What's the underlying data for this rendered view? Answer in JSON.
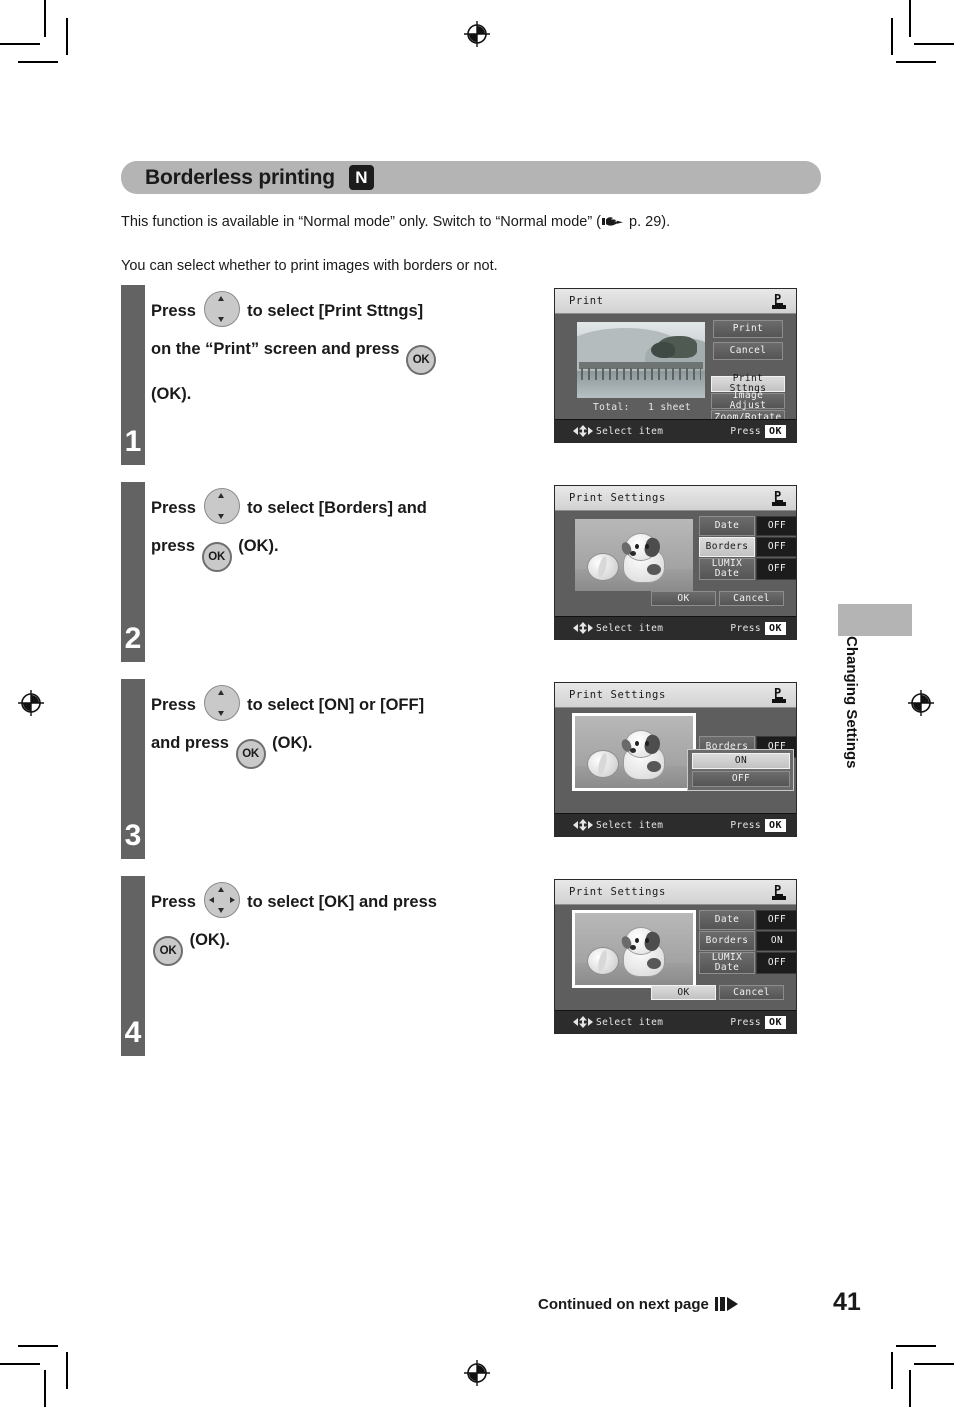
{
  "document": {
    "page_number": "41",
    "side_tab_label": "Changing Settings",
    "footer_note": "Continued on next page"
  },
  "section": {
    "title": "Borderless printing",
    "mode_badge": "N",
    "intro_1_before": "This function is available in “Normal mode” only. Switch to “Normal mode” (",
    "intro_1_after": " p. 29).",
    "intro_2": "You can select whether to print images with borders or not."
  },
  "steps": [
    {
      "number": "1",
      "text_parts": [
        "Press ",
        " to select [Print Sttngs]",
        "on the “Print” screen and press ",
        "(OK)."
      ],
      "line1_pre": "Press",
      "line1_post": "to select [Print Sttngs]",
      "line2_pre": "on the “Print” screen and press",
      "line2_post": "",
      "line3": "(OK).",
      "ok_label": "OK",
      "screen": {
        "title": "Print",
        "icon": "pictbridge-icon",
        "total_label": "Total:",
        "total_value": "1 sheet",
        "buttons": [
          {
            "label": "Print",
            "state": "normal"
          },
          {
            "label": "Cancel",
            "state": "normal"
          },
          {
            "label": "Print Sttngs",
            "state": "selected"
          },
          {
            "label": "Image Adjust",
            "state": "normal"
          },
          {
            "label": "Zoom/Rotate",
            "state": "normal"
          }
        ],
        "footer_left": "Select item",
        "footer_right": "Press",
        "footer_ok": "OK"
      }
    },
    {
      "number": "2",
      "line1_pre": "Press",
      "line1_post": "to select [Borders] and",
      "line2_pre": "press",
      "line2_post": "(OK).",
      "ok_label": "OK",
      "screen": {
        "title": "Print Settings",
        "icon": "pictbridge-icon",
        "rows": [
          {
            "label": "Date",
            "value": "OFF",
            "state": "normal"
          },
          {
            "label": "Borders",
            "value": "OFF",
            "state": "selected"
          },
          {
            "label": "LUMIX Date",
            "value": "OFF",
            "state": "normal"
          }
        ],
        "ok_button": "OK",
        "cancel_button": "Cancel",
        "footer_left": "Select item",
        "footer_right": "Press",
        "footer_ok": "OK"
      }
    },
    {
      "number": "3",
      "line1_pre": "Press",
      "line1_post": "to select [ON] or [OFF]",
      "line2_pre": "and press",
      "line2_post": "(OK).",
      "ok_label": "OK",
      "screen": {
        "title": "Print Settings",
        "icon": "pictbridge-icon",
        "behind_row": {
          "label": "Borders",
          "value": "OFF"
        },
        "popup_options": [
          {
            "label": "ON",
            "state": "selected"
          },
          {
            "label": "OFF",
            "state": "normal"
          }
        ],
        "footer_left": "Select item",
        "footer_right": "Press",
        "footer_ok": "OK"
      }
    },
    {
      "number": "4",
      "line1_pre": "Press",
      "line1_post": "to select [OK] and press",
      "line2_pre": "",
      "line2_post": "(OK).",
      "ok_label": "OK",
      "screen": {
        "title": "Print Settings",
        "icon": "pictbridge-icon",
        "rows": [
          {
            "label": "Date",
            "value": "OFF",
            "state": "normal"
          },
          {
            "label": "Borders",
            "value": "ON",
            "state": "normal"
          },
          {
            "label": "LUMIX Date",
            "value": "OFF",
            "state": "normal"
          }
        ],
        "ok_button": "OK",
        "cancel_button": "Cancel",
        "ok_button_state": "selected",
        "footer_left": "Select item",
        "footer_right": "Press",
        "footer_ok": "OK"
      }
    }
  ],
  "colors": {
    "title_bar": "#b4b4b4",
    "step_bar": "#636363",
    "lcd_body": "#5e5e5e",
    "lcd_footer": "#2c2c2c",
    "value_chip": "#1c1c1c"
  }
}
